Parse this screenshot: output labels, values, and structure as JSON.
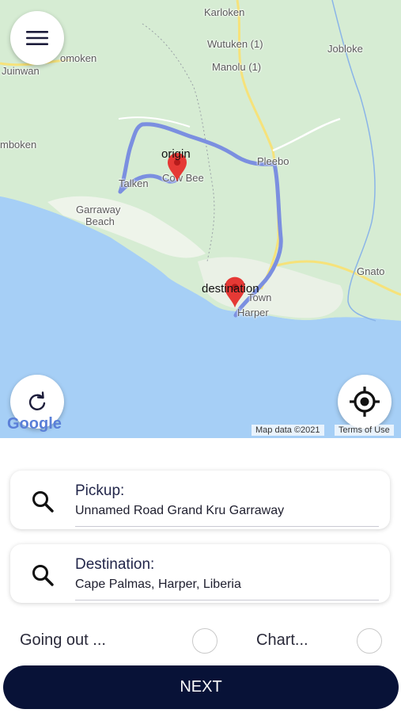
{
  "map": {
    "places": {
      "karloken": "Karloken",
      "wutuken": "Wutuken (1)",
      "manolu": "Manolu (1)",
      "jobloke": "Jobloke",
      "omoken": "omoken",
      "juinwan": "Juinwan",
      "mboken": "mboken",
      "pleebo": "Pleebo",
      "talken": "Talken",
      "cowbee": "Cow Bee",
      "garraway": "Garraway",
      "beach": "Beach",
      "town": "Town",
      "harper": "Harper",
      "gnato": "Gnato"
    },
    "origin_label": "origin",
    "destination_label": "destination",
    "attribution": "Map data ©2021",
    "terms": "Terms of Use",
    "logo": "Google",
    "colors": {
      "water": "#a6cff6",
      "land": "#d6ecd3",
      "route": "#7b8fe0",
      "marker": "#e53935"
    }
  },
  "pickup": {
    "title": "Pickup:",
    "value": "Unnamed Road Grand Kru Garraway"
  },
  "destination": {
    "title": "Destination:",
    "value": "Cape Palmas, Harper, Liberia"
  },
  "options": {
    "going_out": "Going out ...",
    "charter": "Chart..."
  },
  "next_label": "NEXT"
}
